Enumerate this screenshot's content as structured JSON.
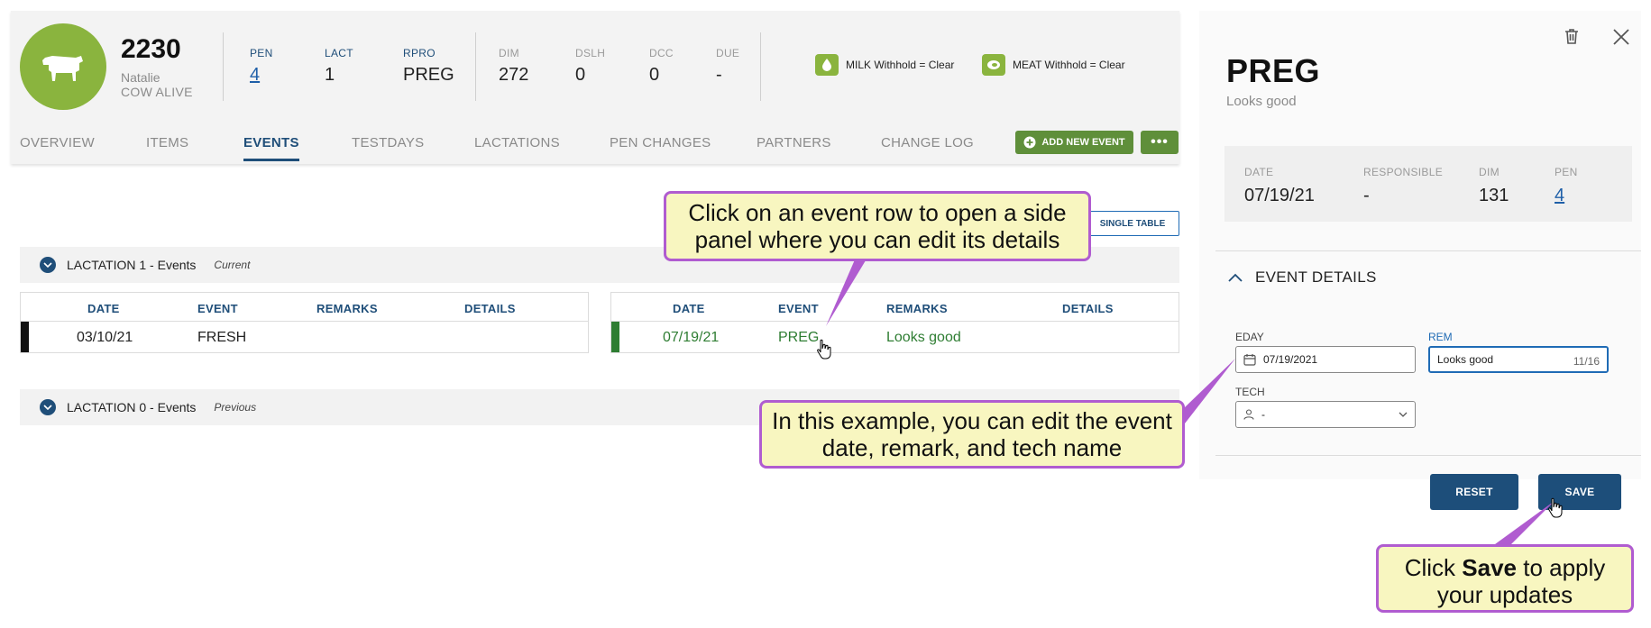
{
  "colors": {
    "brand_green": "#8ab43e",
    "button_green": "#5f8f3a",
    "navy": "#1f4e79",
    "link_blue": "#1f5fa8",
    "event_green": "#2e7d32",
    "callout_fill": "#f8f6c0",
    "callout_border": "#b05cd0"
  },
  "cow": {
    "id": "2230",
    "name": "Natalie",
    "status": "COW ALIVE",
    "icon": "cow-icon"
  },
  "stats": [
    {
      "label": "PEN",
      "value": "4"
    },
    {
      "label": "LACT",
      "value": "1"
    },
    {
      "label": "RPRO",
      "value": "PREG"
    },
    {
      "label": "DIM",
      "value": "272"
    },
    {
      "label": "DSLH",
      "value": "0"
    },
    {
      "label": "DCC",
      "value": "0"
    },
    {
      "label": "DUE",
      "value": "-"
    }
  ],
  "withholds": {
    "milk": "MILK Withhold = Clear",
    "meat": "MEAT Withhold = Clear"
  },
  "tabs": [
    "OVERVIEW",
    "ITEMS",
    "EVENTS",
    "TESTDAYS",
    "LACTATIONS",
    "PEN CHANGES",
    "PARTNERS",
    "CHANGE LOG"
  ],
  "active_tab": "EVENTS",
  "actions": {
    "add_event": "ADD NEW EVENT",
    "more": "•••",
    "single_table": "SINGLE TABLE"
  },
  "lactations": [
    {
      "title": "LACTATION 1 - Events",
      "tag": "Current"
    },
    {
      "title": "LACTATION 0 - Events",
      "tag": "Previous"
    }
  ],
  "table_columns": [
    "DATE",
    "EVENT",
    "REMARKS",
    "DETAILS"
  ],
  "left_table_row": {
    "date": "03/10/21",
    "event": "FRESH",
    "remarks": "",
    "details": ""
  },
  "right_table_row": {
    "date": "07/19/21",
    "event": "PREG",
    "remarks": "Looks good",
    "details": ""
  },
  "panel": {
    "title": "PREG",
    "subtitle": "Looks good",
    "meta": [
      {
        "label": "DATE",
        "value": "07/19/21"
      },
      {
        "label": "RESPONSIBLE",
        "value": "-"
      },
      {
        "label": "DIM",
        "value": "131"
      },
      {
        "label": "PEN",
        "value": "4"
      }
    ],
    "section": "EVENT DETAILS",
    "fields": {
      "eday_label": "EDAY",
      "eday_value": "07/19/2021",
      "rem_label": "REM",
      "rem_value": "Looks good",
      "rem_counter": "11/16",
      "tech_label": "TECH",
      "tech_value": "-"
    },
    "reset": "RESET",
    "save": "SAVE"
  },
  "callouts": {
    "c1": "Click on an event row to open a side panel where you can edit its details",
    "c2": "In this example, you can edit the event date, remark, and tech name",
    "c3_pre": "Click ",
    "c3_bold": "Save",
    "c3_post": " to apply your updates"
  }
}
